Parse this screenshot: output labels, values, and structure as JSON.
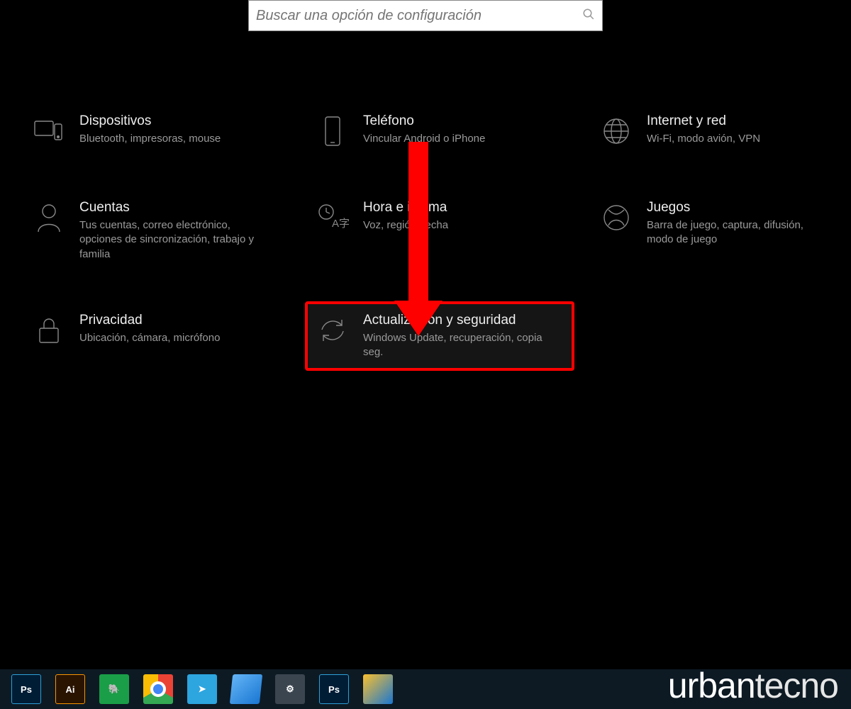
{
  "search": {
    "placeholder": "Buscar una opción de configuración"
  },
  "tiles": {
    "devices": {
      "title": "Dispositivos",
      "sub": "Bluetooth, impresoras, mouse"
    },
    "phone": {
      "title": "Teléfono",
      "sub": "Vincular Android o iPhone"
    },
    "network": {
      "title": "Internet y red",
      "sub": "Wi-Fi, modo avión, VPN"
    },
    "accounts": {
      "title": "Cuentas",
      "sub": "Tus cuentas, correo electrónico, opciones de sincronización, trabajo y familia"
    },
    "time": {
      "title": "Hora e idioma",
      "sub": "Voz, región, fecha"
    },
    "gaming": {
      "title": "Juegos",
      "sub": "Barra de juego, captura, difusión, modo de juego"
    },
    "privacy": {
      "title": "Privacidad",
      "sub": "Ubicación, cámara, micrófono"
    },
    "update": {
      "title": "Actualización y seguridad",
      "sub": "Windows Update, recuperación, copia seg."
    }
  },
  "taskbar": {
    "ps": "Ps",
    "ai": "Ai",
    "ev": "🐘",
    "tg": "➤",
    "gear": "⚙",
    "ps2": "Ps"
  },
  "watermark": {
    "a": "urban",
    "b": "tecno"
  }
}
